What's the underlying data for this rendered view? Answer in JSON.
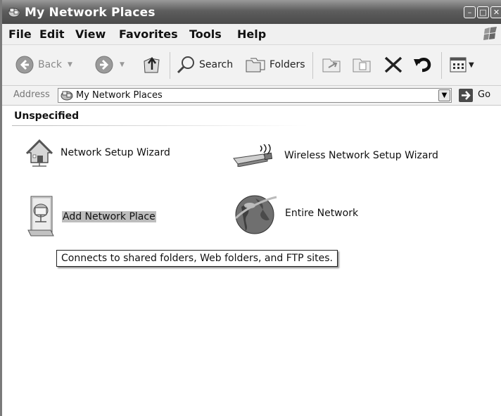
{
  "window": {
    "title": "My Network Places"
  },
  "menubar": {
    "items": [
      "File",
      "Edit",
      "View",
      "Favorites",
      "Tools",
      "Help"
    ]
  },
  "toolbar": {
    "back_label": "Back",
    "search_label": "Search",
    "folders_label": "Folders"
  },
  "address": {
    "label": "Address",
    "value": "My Network Places",
    "go_label": "Go"
  },
  "content": {
    "group_header": "Unspecified",
    "items": [
      {
        "label": "Network Setup Wizard",
        "icon": "house-network-icon"
      },
      {
        "label": "Wireless Network Setup Wizard",
        "icon": "wireless-adapter-icon"
      },
      {
        "label": "Add Network Place",
        "icon": "add-network-place-icon",
        "selected": true
      },
      {
        "label": "Entire Network",
        "icon": "globe-icon"
      }
    ],
    "tooltip": "Connects to shared folders, Web folders, and FTP sites."
  }
}
